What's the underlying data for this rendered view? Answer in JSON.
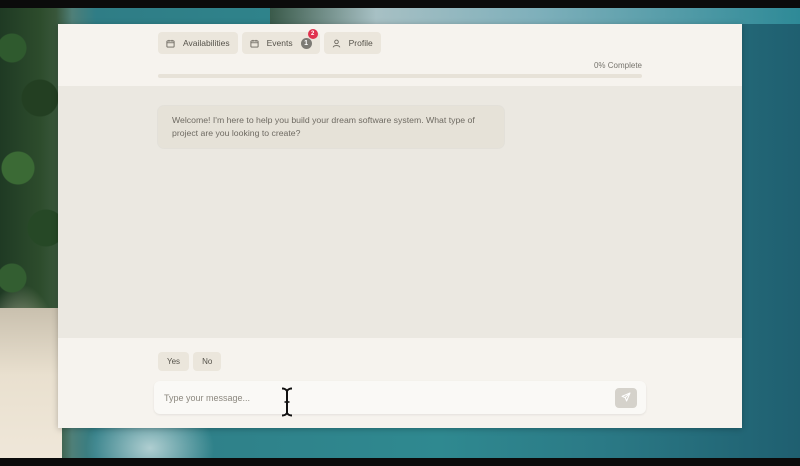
{
  "nav": {
    "tabs": [
      {
        "label": "Availabilities",
        "icon": "calendar-icon"
      },
      {
        "label": "Events",
        "icon": "calendar-icon",
        "count": "1",
        "notification": "2"
      },
      {
        "label": "Profile",
        "icon": "user-icon"
      }
    ]
  },
  "progress": {
    "label": "0% Complete",
    "value": 0
  },
  "chat": {
    "messages": [
      {
        "role": "assistant",
        "text": "Welcome! I'm here to help you build your dream software system. What type of project are you looking to create?"
      }
    ]
  },
  "quick_replies": [
    "Yes",
    "No"
  ],
  "composer": {
    "placeholder": "Type your message...",
    "value": "",
    "send_icon": "send-icon"
  },
  "colors": {
    "app_background": "#f5f2ec",
    "chat_background": "#ebe8e1",
    "badge_red": "#e0314d"
  }
}
